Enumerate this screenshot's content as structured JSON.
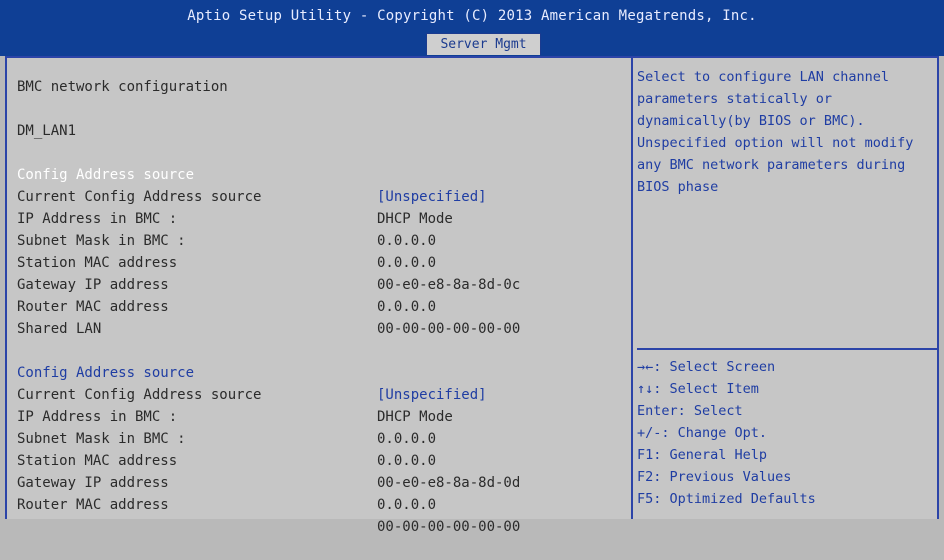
{
  "header": {
    "title": "Aptio Setup Utility - Copyright (C) 2013 American Megatrends, Inc.",
    "active_tab": "Server Mgmt"
  },
  "main": {
    "section_title": "BMC network configuration",
    "groups": [
      {
        "title": "DM_LAN1",
        "rows": [
          {
            "label": "Config Address source",
            "value": "[Unspecified]"
          },
          {
            "label": "Current Config Address source",
            "value": "DHCP Mode"
          },
          {
            "label": "IP Address in BMC :",
            "value": "0.0.0.0"
          },
          {
            "label": "Subnet Mask in BMC :",
            "value": "0.0.0.0"
          },
          {
            "label": "Station MAC address",
            "value": "00-e0-e8-8a-8d-0c"
          },
          {
            "label": "Gateway IP address",
            "value": "0.0.0.0"
          },
          {
            "label": "Router MAC address",
            "value": "00-00-00-00-00-00"
          }
        ]
      },
      {
        "title": "Shared LAN",
        "rows": [
          {
            "label": "Config Address source",
            "value": "[Unspecified]"
          },
          {
            "label": "Current Config Address source",
            "value": "DHCP Mode"
          },
          {
            "label": "IP Address in BMC :",
            "value": "0.0.0.0"
          },
          {
            "label": "Subnet Mask in BMC :",
            "value": "0.0.0.0"
          },
          {
            "label": "Station MAC address",
            "value": "00-e0-e8-8a-8d-0d"
          },
          {
            "label": "Gateway IP address",
            "value": "0.0.0.0"
          },
          {
            "label": "Router MAC address",
            "value": "00-00-00-00-00-00"
          }
        ]
      }
    ]
  },
  "help": {
    "text": "Select to configure LAN channel parameters statically or dynamically(by BIOS or BMC). Unspecified option will not modify any BMC network parameters during BIOS phase"
  },
  "keys": [
    "→←: Select Screen",
    "↑↓: Select Item",
    "Enter: Select",
    "+/-: Change Opt.",
    "F1: General Help",
    "F2: Previous Values",
    "F5: Optimized Defaults"
  ],
  "colors": {
    "header_bg": "#0f3f95",
    "panel_bg": "#c6c6c6",
    "accent": "#1f3da3"
  }
}
